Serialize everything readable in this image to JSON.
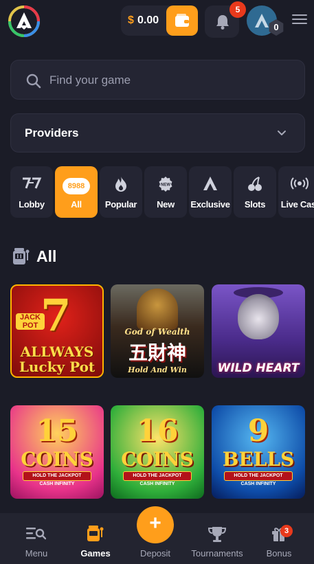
{
  "header": {
    "currency_symbol": "$",
    "balance": "0.00",
    "notifications_count": "5",
    "user_level": "0"
  },
  "search": {
    "placeholder": "Find your game"
  },
  "providers": {
    "label": "Providers"
  },
  "categories": [
    {
      "label": "Lobby",
      "icon": "sevens-icon"
    },
    {
      "label": "All",
      "count": "8988",
      "active": true
    },
    {
      "label": "Popular",
      "icon": "fire-icon"
    },
    {
      "label": "New",
      "icon": "new-badge-icon"
    },
    {
      "label": "Exclusive",
      "icon": "logo-icon"
    },
    {
      "label": "Slots",
      "icon": "cherries-icon"
    },
    {
      "label": "Live Casi",
      "icon": "live-icon"
    }
  ],
  "section": {
    "title": "All",
    "icon": "slot-machine-icon"
  },
  "games": [
    {
      "name": "Allways Lucky Pot",
      "badge": "JACK POT",
      "seven": "7",
      "line1": "ALLWAYS",
      "line2": "Lucky Pot"
    },
    {
      "name": "God of Wealth",
      "line1": "God of Wealth",
      "line2": "五財神",
      "line3": "Hold And Win"
    },
    {
      "name": "Wild Heart",
      "line1": "WILD HEART"
    },
    {
      "name": "15 Coins",
      "num": "15",
      "word": "COINS",
      "ribbon": "HOLD THE JACKPOT",
      "sub": "CASH INFINITY"
    },
    {
      "name": "16 Coins",
      "num": "16",
      "word": "COINS",
      "ribbon": "HOLD THE JACKPOT",
      "sub": "CASH INFINITY"
    },
    {
      "name": "9 Bells",
      "num": "9",
      "word": "BELLS",
      "ribbon": "HOLD THE JACKPOT",
      "sub": "CASH INFINITY"
    }
  ],
  "bottom_nav": {
    "menu": "Menu",
    "games": "Games",
    "deposit": "Deposit",
    "deposit_symbol": "+",
    "tournaments": "Tournaments",
    "bonus": "Bonus",
    "bonus_count": "3"
  },
  "colors": {
    "accent": "#ff9e1b",
    "background": "#1b1c27",
    "card": "#242533",
    "badge": "#e8391c"
  }
}
